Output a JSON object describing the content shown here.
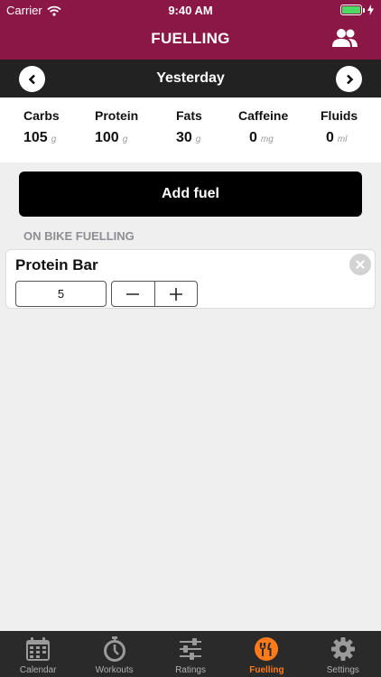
{
  "status_bar": {
    "carrier": "Carrier",
    "time": "9:40 AM",
    "battery_level": 1.0
  },
  "header": {
    "title": "FUELLING",
    "right_icon": "users-icon"
  },
  "date_nav": {
    "label": "Yesterday",
    "prev_icon": "chevron-left-icon",
    "next_icon": "chevron-right-icon"
  },
  "summary": [
    {
      "label": "Carbs",
      "value": "105",
      "unit": "g"
    },
    {
      "label": "Protein",
      "value": "100",
      "unit": "g"
    },
    {
      "label": "Fats",
      "value": "30",
      "unit": "g"
    },
    {
      "label": "Caffeine",
      "value": "0",
      "unit": "mg"
    },
    {
      "label": "Fluids",
      "value": "0",
      "unit": "ml"
    }
  ],
  "add_fuel_label": "Add fuel",
  "section_title": "ON BIKE FUELLING",
  "fuel_items": [
    {
      "name": "Protein Bar",
      "quantity": "5"
    }
  ],
  "tabs": [
    {
      "label": "Calendar",
      "icon": "calendar-icon",
      "active": false
    },
    {
      "label": "Workouts",
      "icon": "stopwatch-icon",
      "active": false
    },
    {
      "label": "Ratings",
      "icon": "sliders-icon",
      "active": false
    },
    {
      "label": "Fuelling",
      "icon": "utensils-icon",
      "active": true
    },
    {
      "label": "Settings",
      "icon": "gear-icon",
      "active": false
    }
  ],
  "colors": {
    "brand": "#8b1746",
    "nav_bar": "#222222",
    "active_tab": "#ff7a1a",
    "battery": "#4cd964"
  }
}
